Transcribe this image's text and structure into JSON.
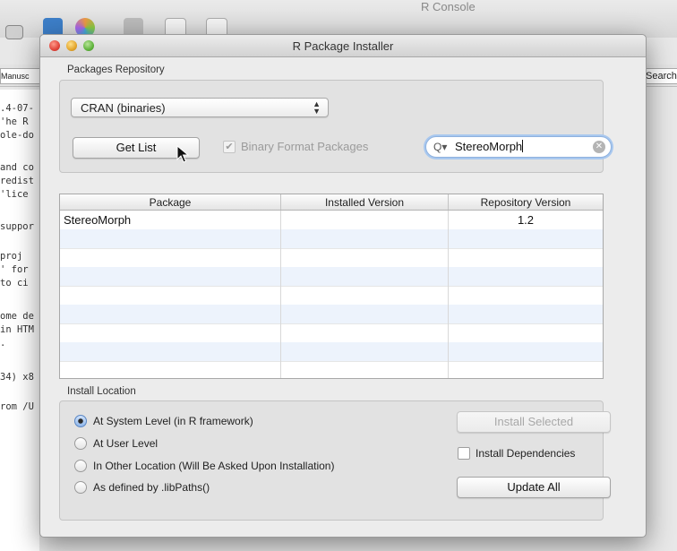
{
  "console": {
    "title": "R Console",
    "left_field": "Manusc",
    "right_field": "Search",
    "lines": [
      ".4-07-",
      "'he R",
      "ole-do",
      "",
      "and co",
      "redist",
      " 'lice",
      "",
      "suppor",
      "",
      " proj",
      "' for",
      " to ci",
      "",
      "ome de",
      "in HTM",
      ".",
      "",
      "34) x8",
      "",
      "rom /U"
    ]
  },
  "window": {
    "title": "R Package Installer"
  },
  "repository": {
    "section_label": "Packages Repository",
    "selected": "CRAN (binaries)",
    "get_list_label": "Get List",
    "binary_format_label": "Binary Format Packages",
    "binary_format_checked": true,
    "search_value": "StereoMorph"
  },
  "table": {
    "columns": [
      "Package",
      "Installed Version",
      "Repository Version"
    ],
    "rows": [
      {
        "package": "StereoMorph",
        "installed": "",
        "repository": "1.2"
      }
    ]
  },
  "install": {
    "section_label": "Install Location",
    "options": [
      {
        "label": "At System Level (in R framework)",
        "selected": true
      },
      {
        "label": "At User Level",
        "selected": false
      },
      {
        "label": "In Other Location (Will Be Asked Upon Installation)",
        "selected": false
      },
      {
        "label": "As defined by .libPaths()",
        "selected": false
      }
    ],
    "install_selected_label": "Install Selected",
    "install_dependencies_label": "Install Dependencies",
    "install_dependencies_checked": false,
    "update_all_label": "Update All"
  }
}
